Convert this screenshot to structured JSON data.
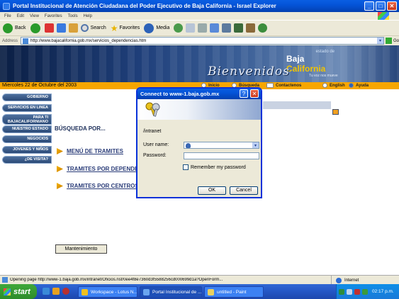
{
  "window": {
    "title": "Portal Institucional de Atención Ciudadana del Poder Ejecutivo de Baja California - Israel Explorer"
  },
  "menubar": [
    "File",
    "Edit",
    "View",
    "Favorites",
    "Tools",
    "Help"
  ],
  "toolbar": {
    "back": "Back",
    "search": "Search",
    "favorites": "Favorites",
    "media": "Media"
  },
  "addressbar": {
    "label": "Address",
    "url": "http://www.bajacalifornia.gob.mx/servicios_dependencias.htm",
    "go": "Go"
  },
  "site": {
    "logo_estado": "estado de",
    "logo_baja": "Baja",
    "logo_california": "California",
    "logo_tag": "Tu voz nos mueve",
    "bienvenidos": "Bienvenidos",
    "date": "Miercoles 22 de Octubre del 2003",
    "nav": {
      "inicio": "Inicio",
      "busqueda": "Búsqueda",
      "contactenos": "Contactenos",
      "english": "English",
      "ayuda": "Ayuda"
    },
    "sidemenu": [
      "GOBIERNO",
      "SERVICIOS EN LINEA",
      "PARA TI BAJACALIFORNIANO",
      "NUESTRO ESTADO",
      "NEGOCIOS",
      "JOVENES Y NIÑOS",
      "¿DE VISITA?"
    ],
    "busqueda_title": "BÚSQUEDA POR...",
    "links": [
      "MENÚ DE TRAMITES",
      "TRAMITES POR DEPENDENCIA",
      "TRAMITES POR CENTROS DE ATENCIÓN"
    ],
    "mantenimiento": "Mantenimiento"
  },
  "dialog": {
    "title": "Connect to www-1.baja.gob.mx",
    "realm": "/intranet",
    "username_label": "User name:",
    "password_label": "Password:",
    "remember_label": "Remember my password",
    "ok": "OK",
    "cancel": "Cancel",
    "help_glyph": "?",
    "close_glyph": "✕"
  },
  "statusbar": {
    "text": "Opening page http://www-1.baja.gob.mx/intranet/Oficios.nsf/0ee4f8e7360d3f5588256cd000699d1a?OpenForm...",
    "zone": "Internet"
  },
  "taskbar": {
    "start": "start",
    "tasks": [
      "Workspace - Lotus N...",
      "Portal Institucional de ...",
      "untitled - Paint"
    ],
    "clock": "02:17 p.m."
  }
}
